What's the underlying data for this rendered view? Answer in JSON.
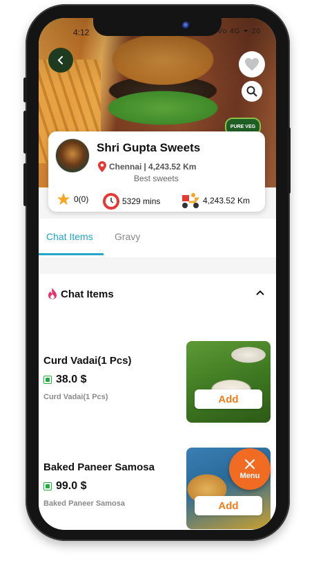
{
  "status_bar": {
    "time": "4:12",
    "right": "Vo 4G ⏷ 20"
  },
  "hero": {
    "veg_badge": "PURE VEG"
  },
  "store": {
    "name": "Shri Gupta Sweets",
    "city": "Chennai",
    "distance": "| 4,243.52 Km",
    "tagline": "Best sweets",
    "rating": "0(0)",
    "time": "5329 mins",
    "delivery_distance": "4,243.52 Km"
  },
  "tabs": [
    {
      "label": "Chat Items",
      "active": true
    },
    {
      "label": "Gravy",
      "active": false
    }
  ],
  "section": {
    "title": "Chat Items"
  },
  "items": [
    {
      "name": "Curd Vadai(1 Pcs)",
      "price": "38.0 $",
      "desc": "Curd Vadai(1 Pcs)",
      "button": "Add"
    },
    {
      "name": "Baked Paneer Samosa",
      "price": "99.0 $",
      "desc": "Baked Paneer Samosa",
      "button": "Add"
    }
  ],
  "fab": {
    "label": "Menu"
  },
  "colors": {
    "accent": "#21a5c8",
    "add": "#f07d1a",
    "fab": "#f26b22",
    "veg": "#1fae3a"
  }
}
